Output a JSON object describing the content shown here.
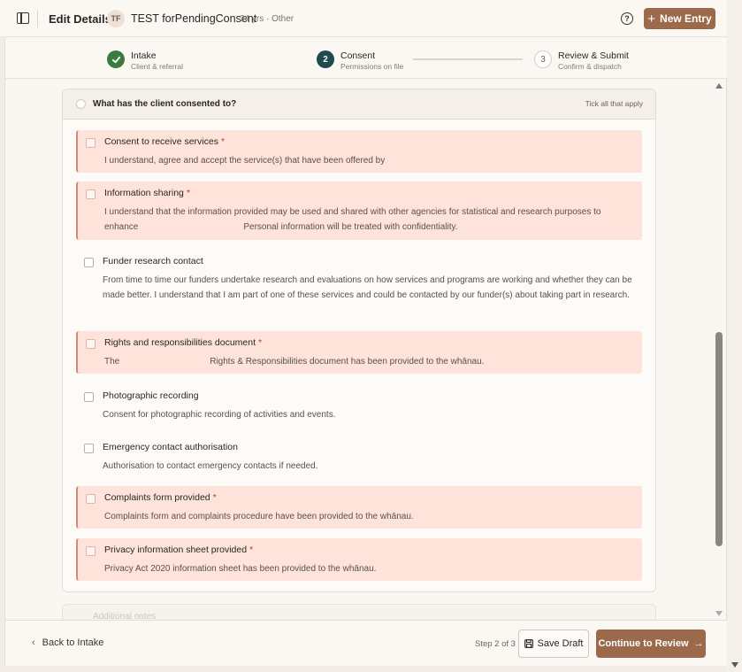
{
  "header": {
    "title": "Edit Details",
    "avatar_initials": "TF",
    "client_name": "TEST forPendingConsent",
    "client_meta": "34 yrs · Other",
    "help_glyph": "?",
    "new_entry_label": "New Entry"
  },
  "stepper": {
    "steps": [
      {
        "number": "1",
        "title": "Intake",
        "subtitle": "Client & referral",
        "state": "complete"
      },
      {
        "number": "2",
        "title": "Consent",
        "subtitle": "Permissions on file",
        "state": "current"
      },
      {
        "number": "3",
        "title": "Review & Submit",
        "subtitle": "Confirm & dispatch",
        "state": "upcoming"
      }
    ]
  },
  "consent_card": {
    "title": "What has the client consented to?",
    "hint": "Tick all that apply",
    "items": [
      {
        "label": "Consent to receive services",
        "required": true,
        "desc": "I understand, agree and accept the service(s) that have been offered by"
      },
      {
        "label": "Information sharing",
        "required": true,
        "desc_a": "I understand that the information provided may be used and shared with other agencies for statistical and research purposes to enhance",
        "desc_b": "Personal information will be treated with confidentiality."
      },
      {
        "label": "Funder research contact",
        "required": false,
        "desc": "From time to time our funders undertake research and evaluations on how services and programs are working and whether they can be made better. I understand that I am part of one of these services and could be contacted by our funder(s) about taking part in research."
      },
      {
        "label": "Rights and responsibilities document",
        "required": true,
        "desc_a": "The",
        "desc_b": "Rights & Responsibilities document has been provided to the whānau."
      },
      {
        "label": "Photographic recording",
        "required": false,
        "desc": "Consent for photographic recording of activities and events."
      },
      {
        "label": "Emergency contact authorisation",
        "required": false,
        "desc": "Authorisation to contact emergency contacts if needed."
      },
      {
        "label": "Complaints form provided",
        "required": true,
        "desc": "Complaints form and complaints procedure have been provided to the whānau."
      },
      {
        "label": "Privacy information sheet provided",
        "required": true,
        "desc": "Privacy Act 2020 information sheet has been provided to the whānau."
      }
    ],
    "required_marker": "*"
  },
  "next_section_title": "Additional notes",
  "footer": {
    "back_label": "Back to Intake",
    "step_count": "Step 2 of 3",
    "save_draft_label": "Save Draft",
    "continue_label": "Continue to Review"
  },
  "colors": {
    "accent": "#9c6a4b",
    "complete": "#3d7a3e",
    "current": "#1f4b4f",
    "required_bg": "#fde3da"
  }
}
